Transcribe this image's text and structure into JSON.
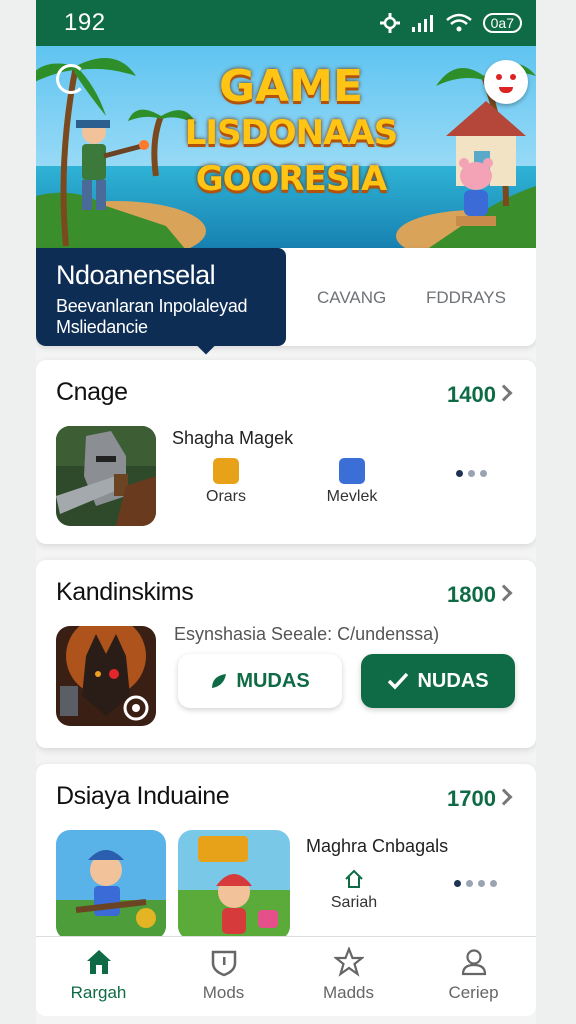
{
  "status_bar": {
    "time": "192",
    "battery": "0a7"
  },
  "hero": {
    "title_line1": "GAME",
    "title_line2": "LISDONAAS",
    "title_line3": "GOORESIA"
  },
  "tabs": {
    "active": {
      "title": "Ndoanenselal",
      "subtitle_line1": "Beevanlaran Inpolaleyad",
      "subtitle_line2": "Msliedancie"
    },
    "tab2": "CAVANG",
    "tab3": "FDDRAYS"
  },
  "cards": [
    {
      "title": "Cnage",
      "count": "1400",
      "subtitle": "Shagha Magek",
      "items": [
        {
          "label": "Orars",
          "icon": "game-app-icon"
        },
        {
          "label": "Mevlek",
          "icon": "chart-app-icon"
        }
      ]
    },
    {
      "title": "Kandinskims",
      "count": "1800",
      "subtitle": "Esynshasia Seeale: C/undenssa)",
      "button_outline": "MUDAS",
      "button_fill": "NUDAS"
    },
    {
      "title": "Dsiaya Induaine",
      "count": "1700",
      "subtitle": "Maghra Cnbagals",
      "items": [
        {
          "label": "Sariah",
          "icon": "home-outline-icon"
        }
      ]
    }
  ],
  "nav": [
    {
      "label": "Rargah",
      "icon": "home-icon",
      "active": true
    },
    {
      "label": "Mods",
      "icon": "shield-icon",
      "active": false
    },
    {
      "label": "Madds",
      "icon": "star-icon",
      "active": false
    },
    {
      "label": "Ceriep",
      "icon": "user-icon",
      "active": false
    }
  ],
  "colors": {
    "brand_green": "#0f6b45",
    "navy": "#0e2d55"
  }
}
